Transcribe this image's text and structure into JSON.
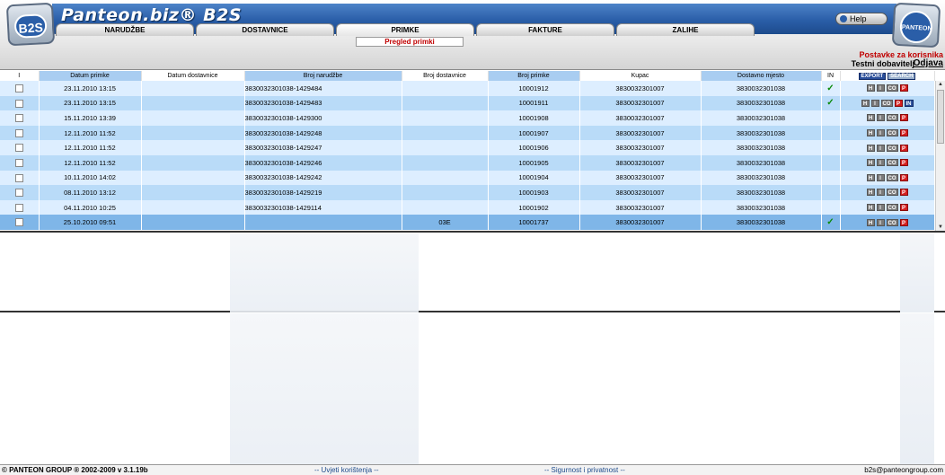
{
  "header": {
    "brand": "Panteon.biz® B2S",
    "logo_left": "B2S",
    "logo_right": "PANTEON",
    "help_label": "Help",
    "tabs": [
      "NARUDŽBE",
      "DOSTAVNICE",
      "PRIMKE",
      "FAKTURE",
      "ZALIHE"
    ],
    "active_tab": "PRIMKE",
    "subtab": "Pregled primki",
    "user_settings": "Postavke za korisnika",
    "user_name": "Testni dobavitelj",
    "logout": "Odjava"
  },
  "grid": {
    "columns": [
      "I",
      "Datum primke",
      "Datum dostavnice",
      "Broj narudžbe",
      "Broj dostavnice",
      "Broj primke",
      "Kupac",
      "Dostavno mjesto",
      "IN"
    ],
    "export_label": "EXPORT",
    "search_label": "SEARCH",
    "rows": [
      {
        "datum_primke": "23.11.2010 13:15",
        "datum_dostavnice": "",
        "broj_narudzbe": "3830032301038-1429484",
        "broj_dostavnice": "",
        "broj_primke": "10001912",
        "kupac": "3830032301007",
        "dostavno_mjesto": "3830032301038",
        "in": "✓",
        "actions": [
          "H",
          "I",
          "CO",
          "P"
        ]
      },
      {
        "datum_primke": "23.11.2010 13:15",
        "datum_dostavnice": "",
        "broj_narudzbe": "3830032301038-1429483",
        "broj_dostavnice": "",
        "broj_primke": "10001911",
        "kupac": "3830032301007",
        "dostavno_mjesto": "3830032301038",
        "in": "✓",
        "actions": [
          "H",
          "I",
          "CO",
          "P",
          "IN"
        ]
      },
      {
        "datum_primke": "15.11.2010 13:39",
        "datum_dostavnice": "",
        "broj_narudzbe": "3830032301038-1429300",
        "broj_dostavnice": "",
        "broj_primke": "10001908",
        "kupac": "3830032301007",
        "dostavno_mjesto": "3830032301038",
        "in": "",
        "actions": [
          "H",
          "I",
          "CO",
          "P"
        ]
      },
      {
        "datum_primke": "12.11.2010 11:52",
        "datum_dostavnice": "",
        "broj_narudzbe": "3830032301038-1429248",
        "broj_dostavnice": "",
        "broj_primke": "10001907",
        "kupac": "3830032301007",
        "dostavno_mjesto": "3830032301038",
        "in": "",
        "actions": [
          "H",
          "I",
          "CO",
          "P"
        ]
      },
      {
        "datum_primke": "12.11.2010 11:52",
        "datum_dostavnice": "",
        "broj_narudzbe": "3830032301038-1429247",
        "broj_dostavnice": "",
        "broj_primke": "10001906",
        "kupac": "3830032301007",
        "dostavno_mjesto": "3830032301038",
        "in": "",
        "actions": [
          "H",
          "I",
          "CO",
          "P"
        ]
      },
      {
        "datum_primke": "12.11.2010 11:52",
        "datum_dostavnice": "",
        "broj_narudzbe": "3830032301038-1429246",
        "broj_dostavnice": "",
        "broj_primke": "10001905",
        "kupac": "3830032301007",
        "dostavno_mjesto": "3830032301038",
        "in": "",
        "actions": [
          "H",
          "I",
          "CO",
          "P"
        ]
      },
      {
        "datum_primke": "10.11.2010 14:02",
        "datum_dostavnice": "",
        "broj_narudzbe": "3830032301038-1429242",
        "broj_dostavnice": "",
        "broj_primke": "10001904",
        "kupac": "3830032301007",
        "dostavno_mjesto": "3830032301038",
        "in": "",
        "actions": [
          "H",
          "I",
          "CO",
          "P"
        ]
      },
      {
        "datum_primke": "08.11.2010 13:12",
        "datum_dostavnice": "",
        "broj_narudzbe": "3830032301038-1429219",
        "broj_dostavnice": "",
        "broj_primke": "10001903",
        "kupac": "3830032301007",
        "dostavno_mjesto": "3830032301038",
        "in": "",
        "actions": [
          "H",
          "I",
          "CO",
          "P"
        ]
      },
      {
        "datum_primke": "04.11.2010 10:25",
        "datum_dostavnice": "",
        "broj_narudzbe": "3830032301038-1429114",
        "broj_dostavnice": "",
        "broj_primke": "10001902",
        "kupac": "3830032301007",
        "dostavno_mjesto": "3830032301038",
        "in": "",
        "actions": [
          "H",
          "I",
          "CO",
          "P"
        ]
      },
      {
        "datum_primke": "25.10.2010 09:51",
        "datum_dostavnice": "",
        "broj_narudzbe": "",
        "broj_dostavnice": "03E",
        "broj_primke": "10001737",
        "kupac": "3830032301007",
        "dostavno_mjesto": "3830032301038",
        "in": "✓",
        "actions": [
          "H",
          "I",
          "CO",
          "P"
        ]
      }
    ]
  },
  "footer": {
    "copyright": "© PANTEON GROUP ® 2002-2009 v 3.1.19b",
    "terms": "-- Uvjeti korištenja --",
    "privacy": "-- Sigurnost i privatnost --",
    "email": "b2s@panteongroup.com"
  },
  "colors": {
    "header_blue": "#2a5ea8",
    "row_light": "#ddeeff",
    "row_dark": "#b9dbf8",
    "row_selected": "#7fb6e8",
    "accent_red": "#c00000"
  }
}
